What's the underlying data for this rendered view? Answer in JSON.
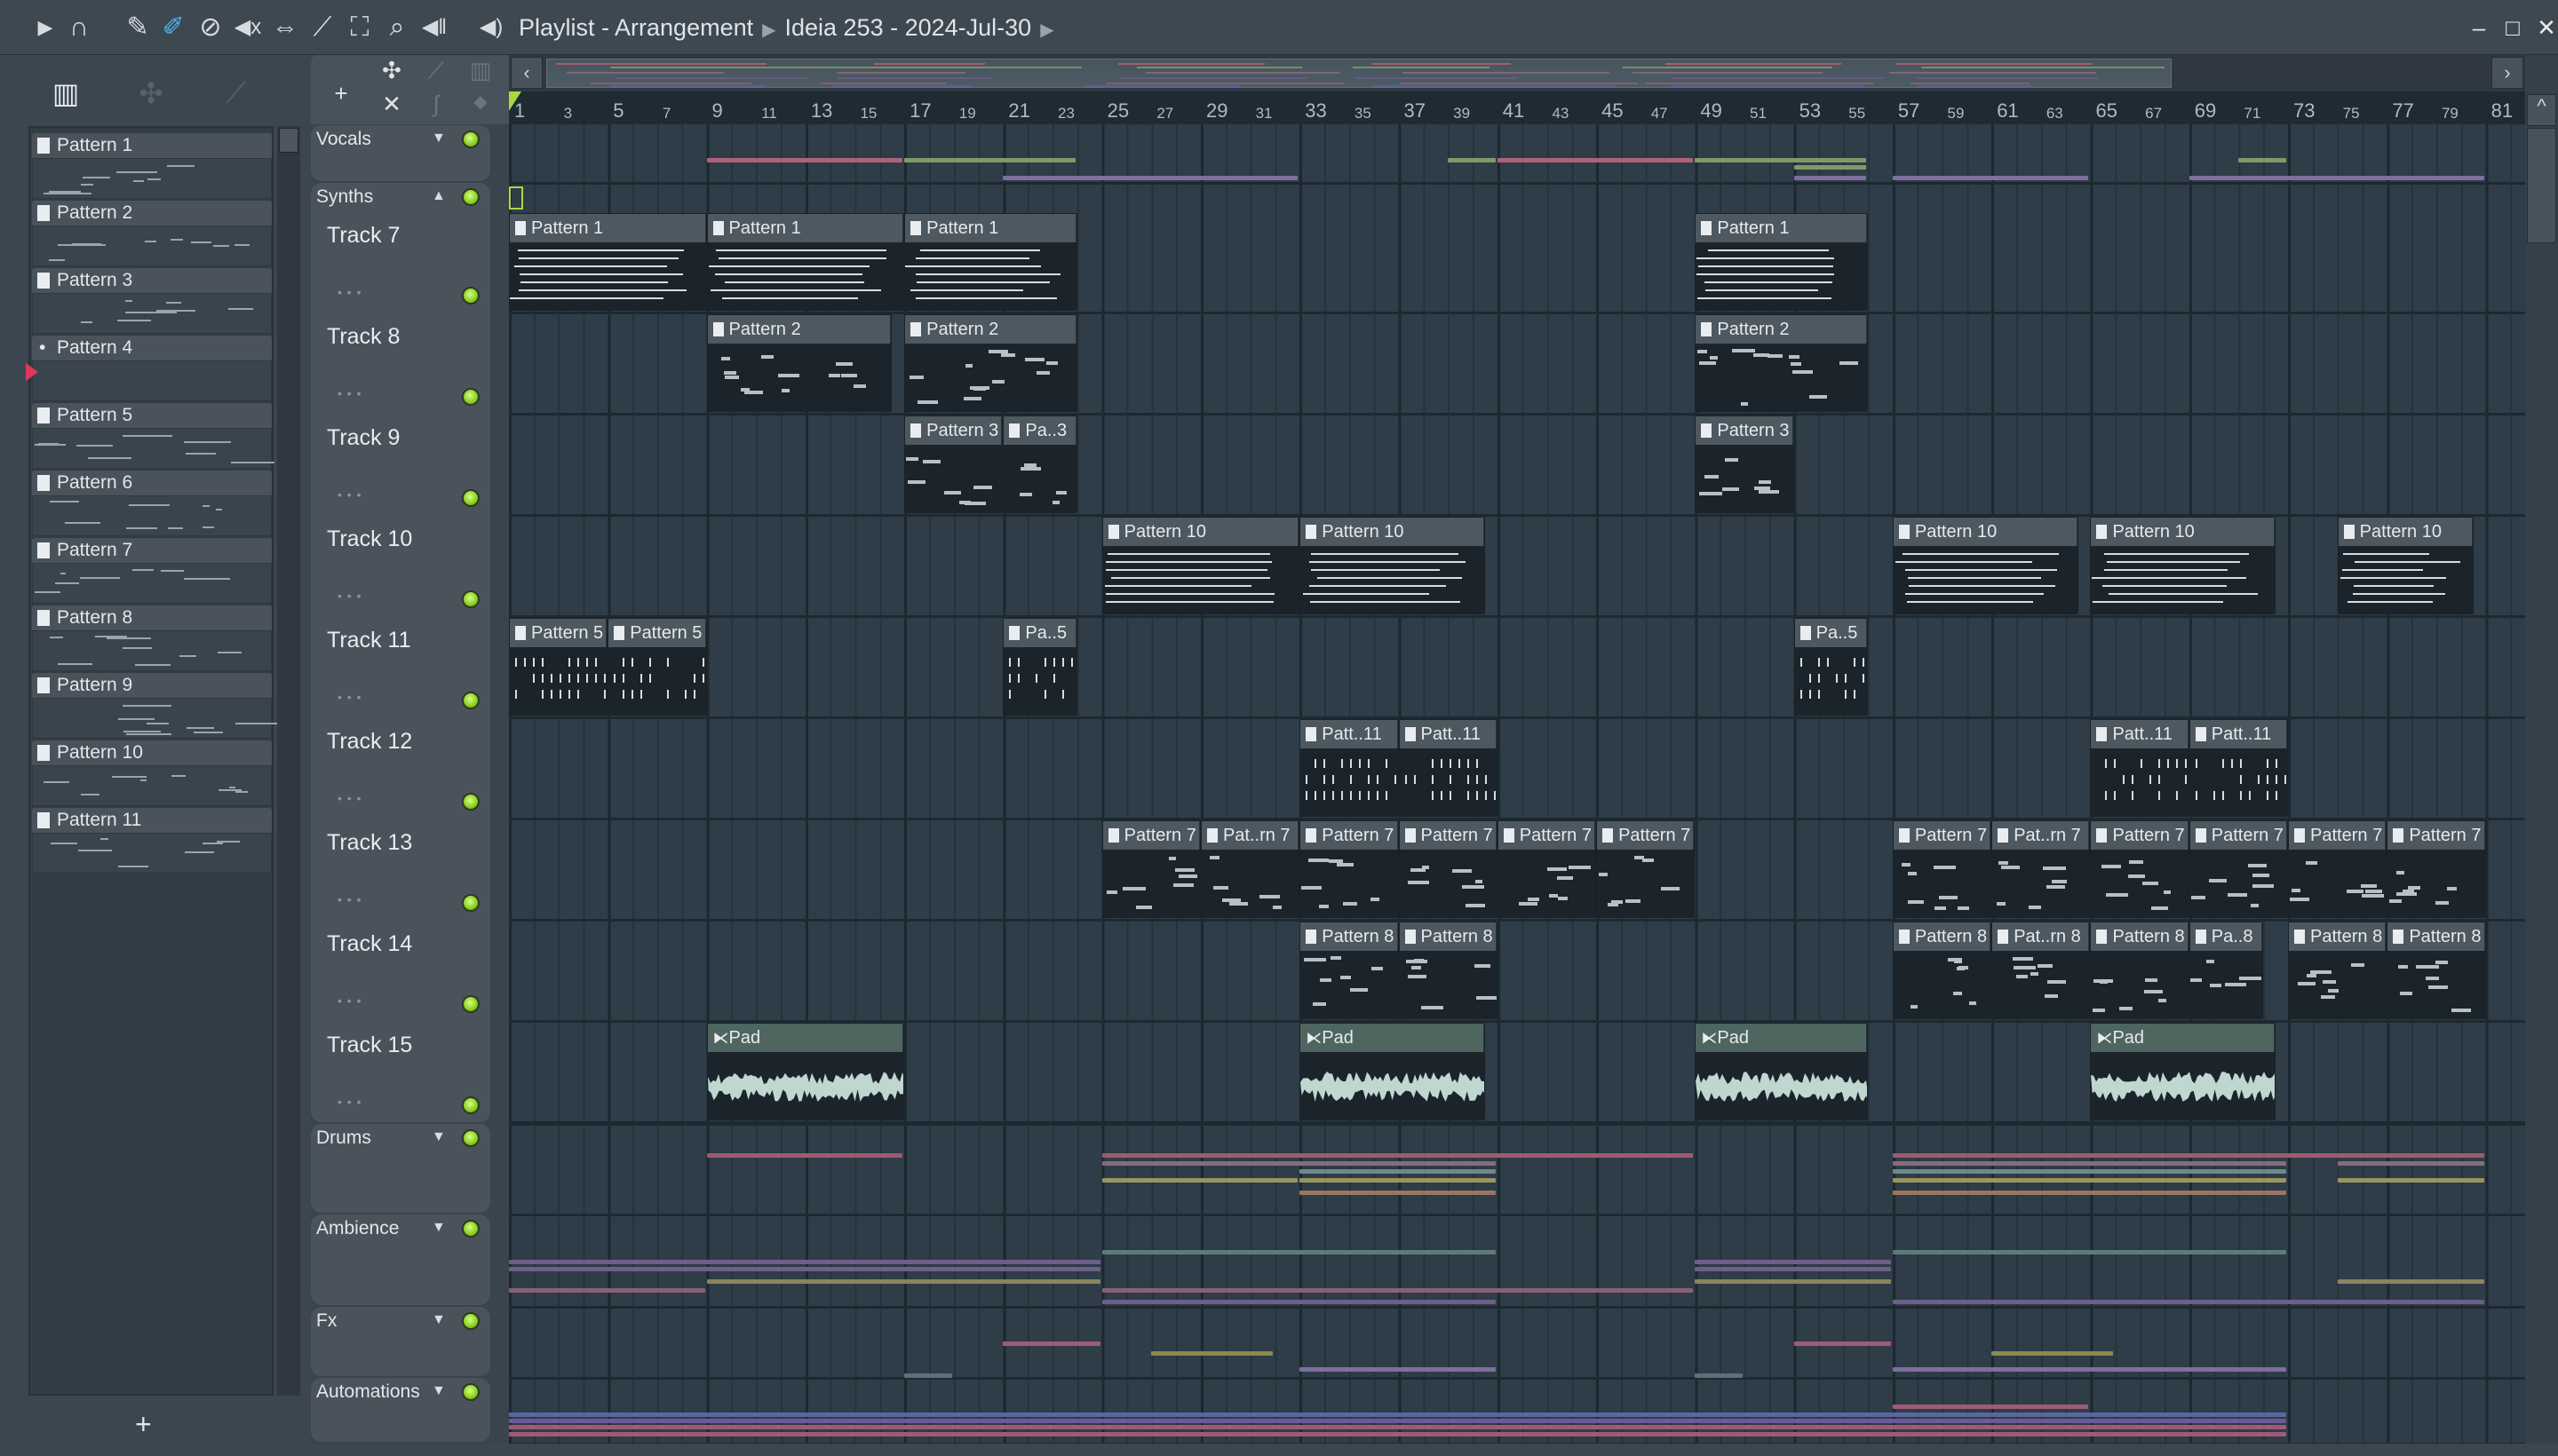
{
  "titlebar": {
    "breadcrumb_app": "Playlist - Arrangement",
    "breadcrumb_project": "Ideia 253 - 2024-Jul-30",
    "tools": [
      "play-icon",
      "magnet-snap-icon",
      "pencil-icon",
      "paint-brush-icon",
      "delete-icon",
      "mute-icon",
      "slip-icon",
      "slice-icon",
      "select-icon",
      "zoom-icon",
      "playback-icon"
    ]
  },
  "accent": {
    "led": "#9be22e",
    "marker": "#a6d944",
    "active_tool": "#4fb4f0",
    "audio_clip": "#4f6660",
    "pattern_clip": "#4d5860"
  },
  "picker": {
    "patterns": [
      "Pattern 1",
      "Pattern 2",
      "Pattern 3",
      "Pattern 4",
      "Pattern 5",
      "Pattern 6",
      "Pattern 7",
      "Pattern 8",
      "Pattern 9",
      "Pattern 10",
      "Pattern 11"
    ],
    "add_label": "+"
  },
  "toolbar2": {
    "add_label": "+"
  },
  "ruler": {
    "bars": [
      1,
      3,
      5,
      7,
      9,
      11,
      13,
      15,
      17,
      19,
      21,
      23,
      25,
      27,
      29,
      31,
      33,
      35,
      37,
      39,
      41,
      43,
      45,
      47,
      49,
      51,
      53,
      55,
      57,
      59,
      61,
      63,
      65,
      67,
      69,
      71,
      73,
      75,
      77,
      79,
      81
    ]
  },
  "groups": [
    {
      "name": "Vocals",
      "collapsed": true,
      "lanes": [
        {
          "lane": 0,
          "start": 9,
          "len": 8,
          "color": "#b0607a"
        },
        {
          "lane": 0,
          "start": 17,
          "len": 7,
          "color": "#7f9a6a"
        },
        {
          "lane": 0,
          "start": 39,
          "len": 2,
          "color": "#7f9a6a"
        },
        {
          "lane": 0,
          "start": 41,
          "len": 8,
          "color": "#b0607a"
        },
        {
          "lane": 0,
          "start": 49,
          "len": 7,
          "color": "#7f9a6a"
        },
        {
          "lane": 0,
          "start": 71,
          "len": 2,
          "color": "#7f9a6a"
        },
        {
          "lane": 1,
          "start": 53,
          "len": 3,
          "color": "#7f9a6a"
        },
        {
          "lane": 2,
          "start": 21,
          "len": 12,
          "color": "#7d6f9e"
        },
        {
          "lane": 2,
          "start": 53,
          "len": 3,
          "color": "#7d6f9e"
        },
        {
          "lane": 2,
          "start": 57,
          "len": 8,
          "color": "#7d6f9e"
        },
        {
          "lane": 2,
          "start": 69,
          "len": 12,
          "color": "#7d6f9e"
        }
      ]
    },
    {
      "name": "Synths",
      "collapsed": false,
      "tracks": [
        "Track 7",
        "Track 8",
        "Track 9",
        "Track 10",
        "Track 11",
        "Track 12",
        "Track 13",
        "Track 14",
        "Track 15"
      ]
    },
    {
      "name": "Drums",
      "collapsed": true,
      "lanes": [
        {
          "lane": 0,
          "start": 9,
          "len": 8,
          "color": "#a05a6e"
        },
        {
          "lane": 0,
          "start": 25,
          "len": 24,
          "color": "#a05a6e"
        },
        {
          "lane": 0,
          "start": 57,
          "len": 24,
          "color": "#a05a6e"
        },
        {
          "lane": 1,
          "start": 25,
          "len": 16,
          "color": "#8a6a7c"
        },
        {
          "lane": 1,
          "start": 57,
          "len": 16,
          "color": "#8a6a7c"
        },
        {
          "lane": 1,
          "start": 75,
          "len": 6,
          "color": "#8a6a7c"
        },
        {
          "lane": 2,
          "start": 33,
          "len": 8,
          "color": "#6d8a8a"
        },
        {
          "lane": 2,
          "start": 57,
          "len": 16,
          "color": "#6d8a8a"
        },
        {
          "lane": 3,
          "start": 25,
          "len": 8,
          "color": "#9a9560"
        },
        {
          "lane": 3,
          "start": 33,
          "len": 8,
          "color": "#9a9560"
        },
        {
          "lane": 3,
          "start": 57,
          "len": 16,
          "color": "#9a9560"
        },
        {
          "lane": 3,
          "start": 75,
          "len": 6,
          "color": "#9a9560"
        },
        {
          "lane": 4,
          "start": 33,
          "len": 8,
          "color": "#9a7560"
        },
        {
          "lane": 4,
          "start": 57,
          "len": 16,
          "color": "#9a7560"
        }
      ]
    },
    {
      "name": "Ambience",
      "collapsed": true,
      "lanes": [
        {
          "lane": 0,
          "start": 25,
          "len": 16,
          "color": "#5f7a7a"
        },
        {
          "lane": 0,
          "start": 57,
          "len": 16,
          "color": "#5f7a7a"
        },
        {
          "lane": 1,
          "start": 1,
          "len": 24,
          "color": "#6c5f88"
        },
        {
          "lane": 1,
          "start": 49,
          "len": 8,
          "color": "#6c5f88"
        },
        {
          "lane": 2,
          "start": 1,
          "len": 24,
          "color": "#6c5f88"
        },
        {
          "lane": 2,
          "start": 49,
          "len": 8,
          "color": "#6c5f88"
        },
        {
          "lane": 3,
          "start": 9,
          "len": 16,
          "color": "#8a8560"
        },
        {
          "lane": 3,
          "start": 49,
          "len": 8,
          "color": "#8a8560"
        },
        {
          "lane": 3,
          "start": 75,
          "len": 6,
          "color": "#8a8560"
        },
        {
          "lane": 4,
          "start": 1,
          "len": 8,
          "color": "#8a5f78"
        },
        {
          "lane": 4,
          "start": 25,
          "len": 24,
          "color": "#8a5f78"
        },
        {
          "lane": 5,
          "start": 25,
          "len": 16,
          "color": "#6c5f88"
        },
        {
          "lane": 5,
          "start": 57,
          "len": 24,
          "color": "#6c5f88"
        }
      ]
    },
    {
      "name": "Fx",
      "collapsed": true,
      "lanes": [
        {
          "lane": 0,
          "start": 21,
          "len": 4,
          "color": "#a05a78"
        },
        {
          "lane": 0,
          "start": 53,
          "len": 4,
          "color": "#a05a78"
        },
        {
          "lane": 1,
          "start": 27,
          "len": 5,
          "color": "#8a8a50"
        },
        {
          "lane": 1,
          "start": 61,
          "len": 5,
          "color": "#8a8a50"
        },
        {
          "lane": 2,
          "start": 33,
          "len": 8,
          "color": "#7d6f9e"
        },
        {
          "lane": 2,
          "start": 57,
          "len": 16,
          "color": "#7d6f9e"
        },
        {
          "lane": 3,
          "start": 17,
          "len": 2,
          "color": "#5f6f78"
        },
        {
          "lane": 3,
          "start": 49,
          "len": 2,
          "color": "#5f6f78"
        }
      ]
    },
    {
      "name": "Automations",
      "collapsed": true,
      "lanes": [
        {
          "lane": 0,
          "start": 57,
          "len": 8,
          "color": "#a05a78"
        },
        {
          "lane": 1,
          "start": 1,
          "len": 72,
          "color": "#5a66a0"
        },
        {
          "lane": 2,
          "start": 1,
          "len": 72,
          "color": "#6a5a98"
        },
        {
          "lane": 3,
          "start": 1,
          "len": 72,
          "color": "#a05a78"
        },
        {
          "lane": 4,
          "start": 1,
          "len": 72,
          "color": "#a05a78"
        }
      ]
    }
  ],
  "clips": [
    {
      "track": 0,
      "start": 1,
      "len": 8,
      "label": "Pattern 1"
    },
    {
      "track": 0,
      "start": 9,
      "len": 8,
      "label": "Pattern 1"
    },
    {
      "track": 0,
      "start": 17,
      "len": 7,
      "label": "Pattern 1"
    },
    {
      "track": 0,
      "start": 49,
      "len": 7,
      "label": "Pattern 1"
    },
    {
      "track": 1,
      "start": 9,
      "len": 7.5,
      "label": "Pattern 2"
    },
    {
      "track": 1,
      "start": 17,
      "len": 7,
      "label": "Pattern 2"
    },
    {
      "track": 1,
      "start": 49,
      "len": 7,
      "label": "Pattern 2"
    },
    {
      "track": 2,
      "start": 17,
      "len": 4,
      "label": "Pattern 3"
    },
    {
      "track": 2,
      "start": 21,
      "len": 3,
      "label": "Pa..3"
    },
    {
      "track": 2,
      "start": 49,
      "len": 4,
      "label": "Pattern 3"
    },
    {
      "track": 3,
      "start": 25,
      "len": 8,
      "label": "Pattern 10"
    },
    {
      "track": 3,
      "start": 33,
      "len": 7.5,
      "label": "Pattern 10"
    },
    {
      "track": 3,
      "start": 57,
      "len": 7.5,
      "label": "Pattern 10"
    },
    {
      "track": 3,
      "start": 65,
      "len": 7.5,
      "label": "Pattern 10"
    },
    {
      "track": 3,
      "start": 75,
      "len": 5.5,
      "label": "Pattern 10"
    },
    {
      "track": 4,
      "start": 1,
      "len": 4,
      "label": "Pattern 5"
    },
    {
      "track": 4,
      "start": 5,
      "len": 4,
      "label": "Pattern 5"
    },
    {
      "track": 4,
      "start": 21,
      "len": 3,
      "label": "Pa..5"
    },
    {
      "track": 4,
      "start": 53,
      "len": 3,
      "label": "Pa..5"
    },
    {
      "track": 5,
      "start": 33,
      "len": 4,
      "label": "Patt..11"
    },
    {
      "track": 5,
      "start": 37,
      "len": 4,
      "label": "Patt..11"
    },
    {
      "track": 5,
      "start": 65,
      "len": 4,
      "label": "Patt..11"
    },
    {
      "track": 5,
      "start": 69,
      "len": 4,
      "label": "Patt..11"
    },
    {
      "track": 6,
      "start": 25,
      "len": 4,
      "label": "Pattern 7"
    },
    {
      "track": 6,
      "start": 29,
      "len": 4,
      "label": "Pat..rn 7"
    },
    {
      "track": 6,
      "start": 33,
      "len": 4,
      "label": "Pattern 7"
    },
    {
      "track": 6,
      "start": 37,
      "len": 4,
      "label": "Pattern 7"
    },
    {
      "track": 6,
      "start": 41,
      "len": 4,
      "label": "Pattern 7"
    },
    {
      "track": 6,
      "start": 45,
      "len": 4,
      "label": "Pattern 7"
    },
    {
      "track": 6,
      "start": 57,
      "len": 4,
      "label": "Pattern 7"
    },
    {
      "track": 6,
      "start": 61,
      "len": 4,
      "label": "Pat..rn 7"
    },
    {
      "track": 6,
      "start": 65,
      "len": 4,
      "label": "Pattern 7"
    },
    {
      "track": 6,
      "start": 69,
      "len": 4,
      "label": "Pattern 7"
    },
    {
      "track": 6,
      "start": 73,
      "len": 4,
      "label": "Pattern 7"
    },
    {
      "track": 6,
      "start": 77,
      "len": 4,
      "label": "Pattern 7"
    },
    {
      "track": 7,
      "start": 33,
      "len": 4,
      "label": "Pattern 8"
    },
    {
      "track": 7,
      "start": 37,
      "len": 4,
      "label": "Pattern 8"
    },
    {
      "track": 7,
      "start": 57,
      "len": 4,
      "label": "Pattern 8"
    },
    {
      "track": 7,
      "start": 61,
      "len": 4,
      "label": "Pat..rn 8"
    },
    {
      "track": 7,
      "start": 65,
      "len": 4,
      "label": "Pattern 8"
    },
    {
      "track": 7,
      "start": 69,
      "len": 3,
      "label": "Pa..8"
    },
    {
      "track": 7,
      "start": 73,
      "len": 4,
      "label": "Pattern 8"
    },
    {
      "track": 7,
      "start": 77,
      "len": 4,
      "label": "Pattern 8"
    },
    {
      "track": 8,
      "start": 9,
      "len": 8,
      "label": "Pad",
      "audio": true
    },
    {
      "track": 8,
      "start": 33,
      "len": 7.5,
      "label": "Pad",
      "audio": true
    },
    {
      "track": 8,
      "start": 49,
      "len": 7,
      "label": "Pad",
      "audio": true
    },
    {
      "track": 8,
      "start": 65,
      "len": 7.5,
      "label": "Pad",
      "audio": true
    }
  ]
}
